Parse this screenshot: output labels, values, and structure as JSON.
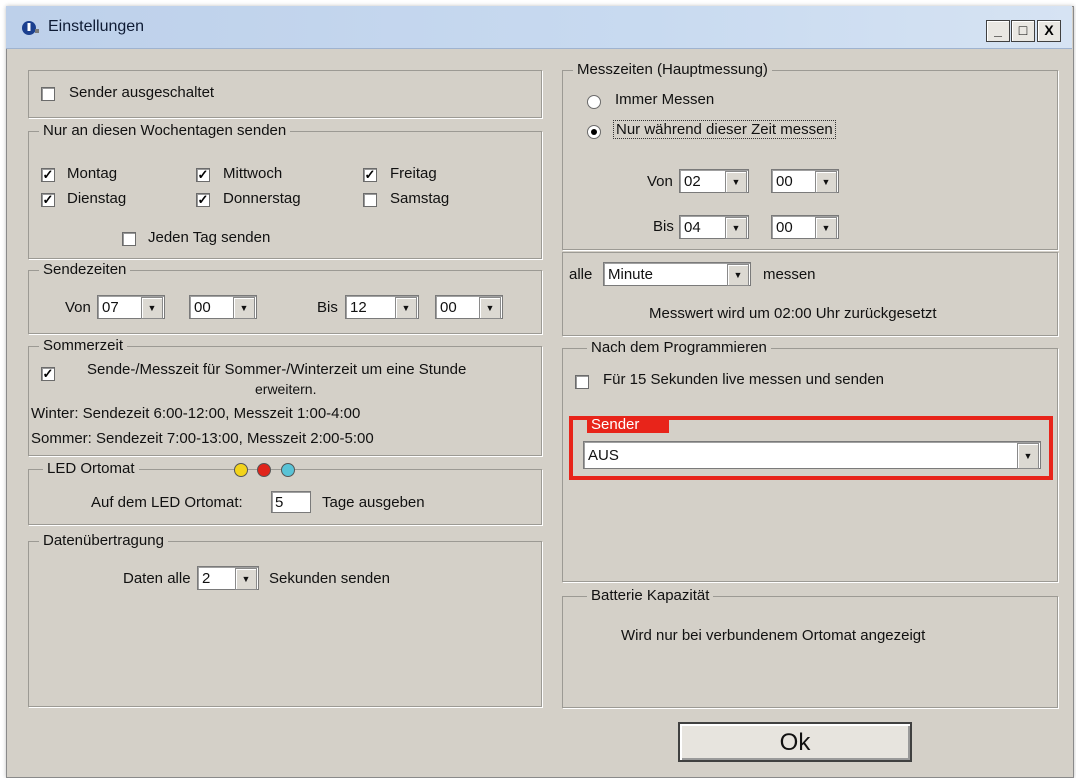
{
  "window": {
    "title": "Einstellungen",
    "controls": {
      "minimize": "_",
      "maximize": "□",
      "close": "X"
    }
  },
  "sender_off": {
    "label": "Sender ausgeschaltet",
    "checked": false
  },
  "weekdays": {
    "legend": "Nur an diesen Wochentagen senden",
    "days": [
      {
        "label": "Montag",
        "checked": true
      },
      {
        "label": "Mittwoch",
        "checked": true
      },
      {
        "label": "Freitag",
        "checked": true
      },
      {
        "label": "Dienstag",
        "checked": true
      },
      {
        "label": "Donnerstag",
        "checked": true
      },
      {
        "label": "Samstag",
        "checked": false
      }
    ],
    "every_day": {
      "label": "Jeden Tag senden",
      "checked": false
    }
  },
  "send_times": {
    "legend": "Sendezeiten",
    "from_label": "Von",
    "from_hour": "07",
    "from_min": "00",
    "to_label": "Bis",
    "to_hour": "12",
    "to_min": "00"
  },
  "summer_time": {
    "legend": "Sommerzeit",
    "checkbox_line1": "Sende-/Messzeit für Sommer-/Winterzeit um eine Stunde",
    "checkbox_line2": "erweitern.",
    "checked": true,
    "winter": "Winter: Sendezeit 6:00-12:00, Messzeit 1:00-4:00",
    "summer": "Sommer: Sendezeit 7:00-13:00, Messzeit 2:00-5:00"
  },
  "led": {
    "legend": "LED Ortomat",
    "label": "Auf dem LED Ortomat:",
    "value": "5",
    "suffix": "Tage ausgeben",
    "colors": {
      "yellow": "#f2d31b",
      "red": "#e0241b",
      "cyan": "#59c3d6"
    }
  },
  "data_transfer": {
    "legend": "Datenübertragung",
    "prefix": "Daten alle",
    "value": "2",
    "suffix": "Sekunden senden"
  },
  "measure_times": {
    "legend": "Messzeiten (Hauptmessung)",
    "always": "Immer Messen",
    "only_during": "Nur während dieser Zeit messen",
    "from_label": "Von",
    "from_hour": "02",
    "from_min": "00",
    "to_label": "Bis",
    "to_hour": "04",
    "to_min": "00"
  },
  "interval": {
    "prefix": "alle",
    "value": "Minute",
    "suffix": "messen",
    "reset_note": "Messwert wird um 02:00 Uhr zurückgesetzt"
  },
  "after_programming": {
    "legend": "Nach dem Programmieren",
    "checkbox": "Für 15 Sekunden live messen und  senden",
    "checked": false
  },
  "sender": {
    "legend": "Sender",
    "value": "AUS",
    "highlight": "#e8241a"
  },
  "battery": {
    "legend": "Batterie Kapazität",
    "note": "Wird nur bei verbundenem Ortomat angezeigt"
  },
  "ok_button": "Ok"
}
